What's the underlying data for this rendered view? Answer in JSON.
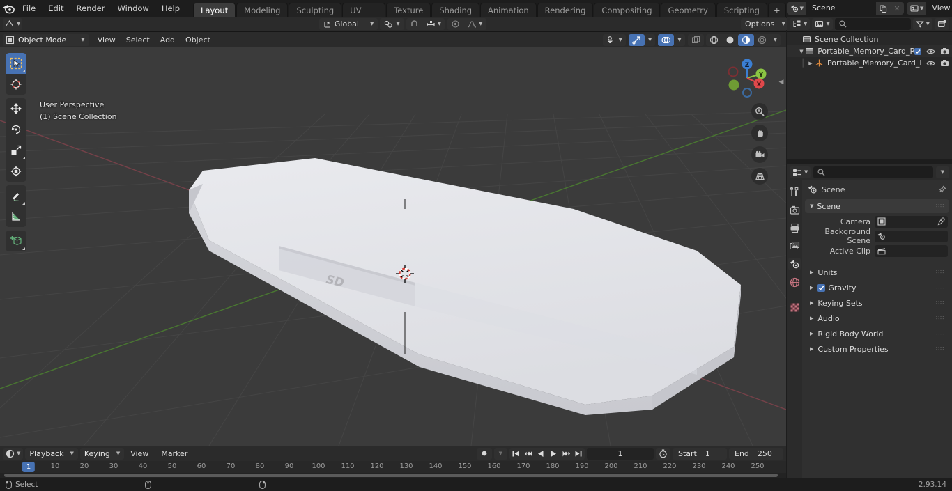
{
  "app": {
    "name": "Blender",
    "version": "2.93.14"
  },
  "topbar": {
    "menus": [
      "File",
      "Edit",
      "Render",
      "Window",
      "Help"
    ],
    "workspaces": [
      {
        "label": "Layout",
        "active": true
      },
      {
        "label": "Modeling",
        "active": false
      },
      {
        "label": "Sculpting",
        "active": false
      },
      {
        "label": "UV Editing",
        "active": false
      },
      {
        "label": "Texture Paint",
        "active": false
      },
      {
        "label": "Shading",
        "active": false
      },
      {
        "label": "Animation",
        "active": false
      },
      {
        "label": "Rendering",
        "active": false
      },
      {
        "label": "Compositing",
        "active": false
      },
      {
        "label": "Geometry Nodes",
        "active": false
      },
      {
        "label": "Scripting",
        "active": false
      }
    ],
    "add_workspace": "+",
    "scene_name": "Scene",
    "view_layer_name": "View Layer"
  },
  "viewport_header": {
    "mode": "Object Mode",
    "menus": [
      "View",
      "Select",
      "Add",
      "Object"
    ],
    "transform_orientation": "Global",
    "options_label": "Options"
  },
  "viewport": {
    "perspective_label": "User Perspective",
    "collection_label": "(1) Scene Collection",
    "gizmo_axes": [
      {
        "label": "Z",
        "color": "#3b7fd4"
      },
      {
        "label": "Y",
        "color": "#8bc543"
      },
      {
        "label": "X",
        "color": "#e0484b"
      }
    ],
    "background_color": "#3b3b3b",
    "object_color": "#dcdde1",
    "object_text": "SD"
  },
  "outliner": {
    "search_placeholder": "",
    "rows": [
      {
        "label": "Scene Collection",
        "indent": 0,
        "icon": "collection-icon",
        "disclosure": "",
        "checkbox": false,
        "eye": false,
        "camera": false
      },
      {
        "label": "Portable_Memory_Card_Reac",
        "indent": 1,
        "icon": "collection-icon",
        "disclosure": "open",
        "checkbox": true,
        "eye": true,
        "camera": true
      },
      {
        "label": "Portable_Memory_Card_I",
        "indent": 2,
        "icon": "empty-icon",
        "disclosure": "closed",
        "checkbox": false,
        "eye": true,
        "camera": true
      }
    ]
  },
  "properties": {
    "search_placeholder": "",
    "breadcrumb": "Scene",
    "panels": [
      {
        "label": "Scene",
        "expanded": true,
        "checkbox": null
      },
      {
        "label": "Units",
        "expanded": false,
        "checkbox": null
      },
      {
        "label": "Gravity",
        "expanded": false,
        "checkbox": true
      },
      {
        "label": "Keying Sets",
        "expanded": false,
        "checkbox": null
      },
      {
        "label": "Audio",
        "expanded": false,
        "checkbox": null
      },
      {
        "label": "Rigid Body World",
        "expanded": false,
        "checkbox": null
      },
      {
        "label": "Custom Properties",
        "expanded": false,
        "checkbox": null
      }
    ],
    "fields": [
      {
        "label": "Camera",
        "value": "",
        "icon": "camera-object-icon",
        "eyedropper": true
      },
      {
        "label": "Background Scene",
        "value": "",
        "icon": "scene-icon",
        "eyedropper": false
      },
      {
        "label": "Active Clip",
        "value": "",
        "icon": "clip-icon",
        "eyedropper": false
      }
    ],
    "tabs": [
      {
        "name": "tool-tab",
        "active": false
      },
      {
        "name": "render-tab",
        "active": false
      },
      {
        "name": "output-tab",
        "active": false
      },
      {
        "name": "view-layer-tab",
        "active": false
      },
      {
        "name": "scene-tab",
        "active": true
      },
      {
        "name": "world-tab",
        "active": false
      },
      {
        "name": "texture-tab",
        "active": false
      }
    ]
  },
  "timeline": {
    "playback_label": "Playback",
    "keying_label": "Keying",
    "view_label": "View",
    "marker_label": "Marker",
    "current_frame": "1",
    "start_label": "Start",
    "start_value": "1",
    "end_label": "End",
    "end_value": "250",
    "ticks": [
      "10",
      "20",
      "30",
      "40",
      "50",
      "60",
      "70",
      "80",
      "90",
      "100",
      "110",
      "120",
      "130",
      "140",
      "150",
      "160",
      "170",
      "180",
      "190",
      "200",
      "210",
      "220",
      "230",
      "240",
      "250"
    ],
    "playhead_frame": "1"
  },
  "statusbar": {
    "select_label": "Select",
    "version": "2.93.14"
  }
}
